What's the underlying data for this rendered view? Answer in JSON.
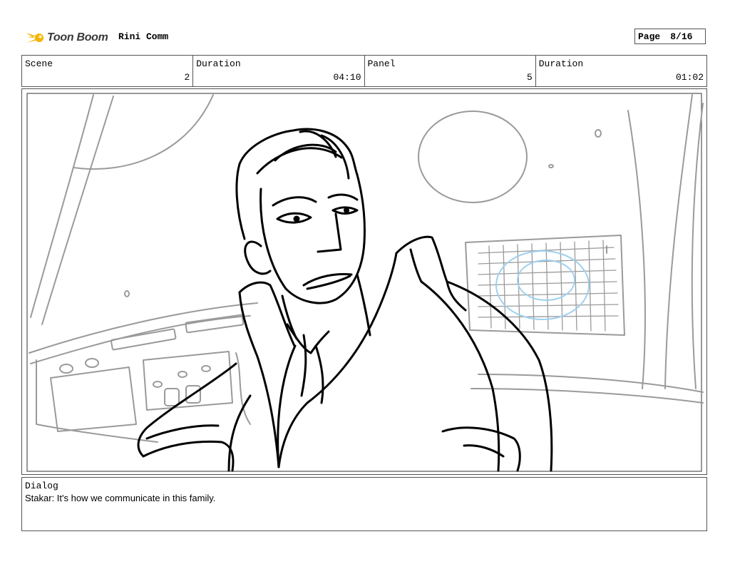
{
  "header": {
    "logo_text": "Toon Boom",
    "project_title": "Rini Comm",
    "page_label": "Page",
    "page_number": "8/16"
  },
  "info": {
    "scene_label": "Scene",
    "scene_value": "2",
    "duration_label": "Duration",
    "duration_value": "04:10",
    "panel_label": "Panel",
    "panel_value": "5",
    "panel_duration_label": "Duration",
    "panel_duration_value": "01:02"
  },
  "dialog": {
    "label": "Dialog",
    "text": "Stakar: It's how we communicate in this family."
  },
  "colors": {
    "logo_accent": "#f5b400",
    "sketch_line": "#000000",
    "background_line": "#9a9a9a",
    "blue_guide": "#9fd0ee"
  }
}
